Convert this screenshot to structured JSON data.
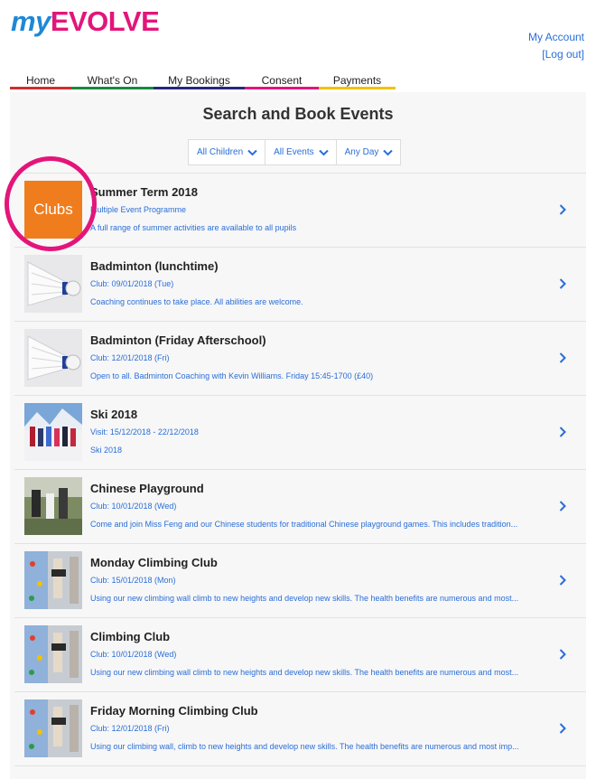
{
  "logo": {
    "my": "my",
    "evolve": "EVOLVE"
  },
  "account": {
    "my_account": "My Account",
    "logout": "[Log out]"
  },
  "nav": [
    {
      "label": "Home",
      "color": "#d22d2d"
    },
    {
      "label": "What's On",
      "color": "#178a3e"
    },
    {
      "label": "My Bookings",
      "color": "#232a7a"
    },
    {
      "label": "Consent",
      "color": "#e3157a"
    },
    {
      "label": "Payments",
      "color": "#f2c200"
    }
  ],
  "page_title": "Search and Book Events",
  "filters": [
    {
      "label": "All Children",
      "icon": "chevron-down-icon"
    },
    {
      "label": "All Events",
      "icon": "chevron-down-icon"
    },
    {
      "label": "Any Day",
      "icon": "chevron-down-icon"
    }
  ],
  "events": [
    {
      "title": "Summer Term 2018",
      "sub": "Multiple Event Programme",
      "desc": "A full range of summer activities are available to all pupils",
      "thumb": "Clubs"
    },
    {
      "title": "Badminton (lunchtime)",
      "sub": "Club: 09/01/2018 (Tue)",
      "desc": "Coaching continues to take place. All abilities are welcome."
    },
    {
      "title": "Badminton (Friday Afterschool)",
      "sub": "Club: 12/01/2018 (Fri)",
      "desc": "Open to all. Badminton Coaching with Kevin Williams. Friday 15:45-1700 (£40)"
    },
    {
      "title": "Ski 2018",
      "sub": "Visit: 15/12/2018 - 22/12/2018",
      "desc": "Ski 2018"
    },
    {
      "title": "Chinese Playground",
      "sub": "Club: 10/01/2018 (Wed)",
      "desc": "Come and join Miss Feng and our Chinese students for traditional Chinese playground games. This includes tradition..."
    },
    {
      "title": "Monday Climbing Club",
      "sub": "Club: 15/01/2018 (Mon)",
      "desc": "Using our new climbing wall climb to new heights and develop new skills. The health benefits are numerous and most..."
    },
    {
      "title": "Climbing Club",
      "sub": "Club: 10/01/2018 (Wed)",
      "desc": "Using our new climbing wall climb to new heights and develop new skills. The health benefits are numerous and most..."
    },
    {
      "title": "Friday Morning Climbing Club",
      "sub": "Club: 12/01/2018 (Fri)",
      "desc": "Using our climbing wall, climb to new heights and develop new skills. The health benefits are numerous and most imp..."
    }
  ]
}
